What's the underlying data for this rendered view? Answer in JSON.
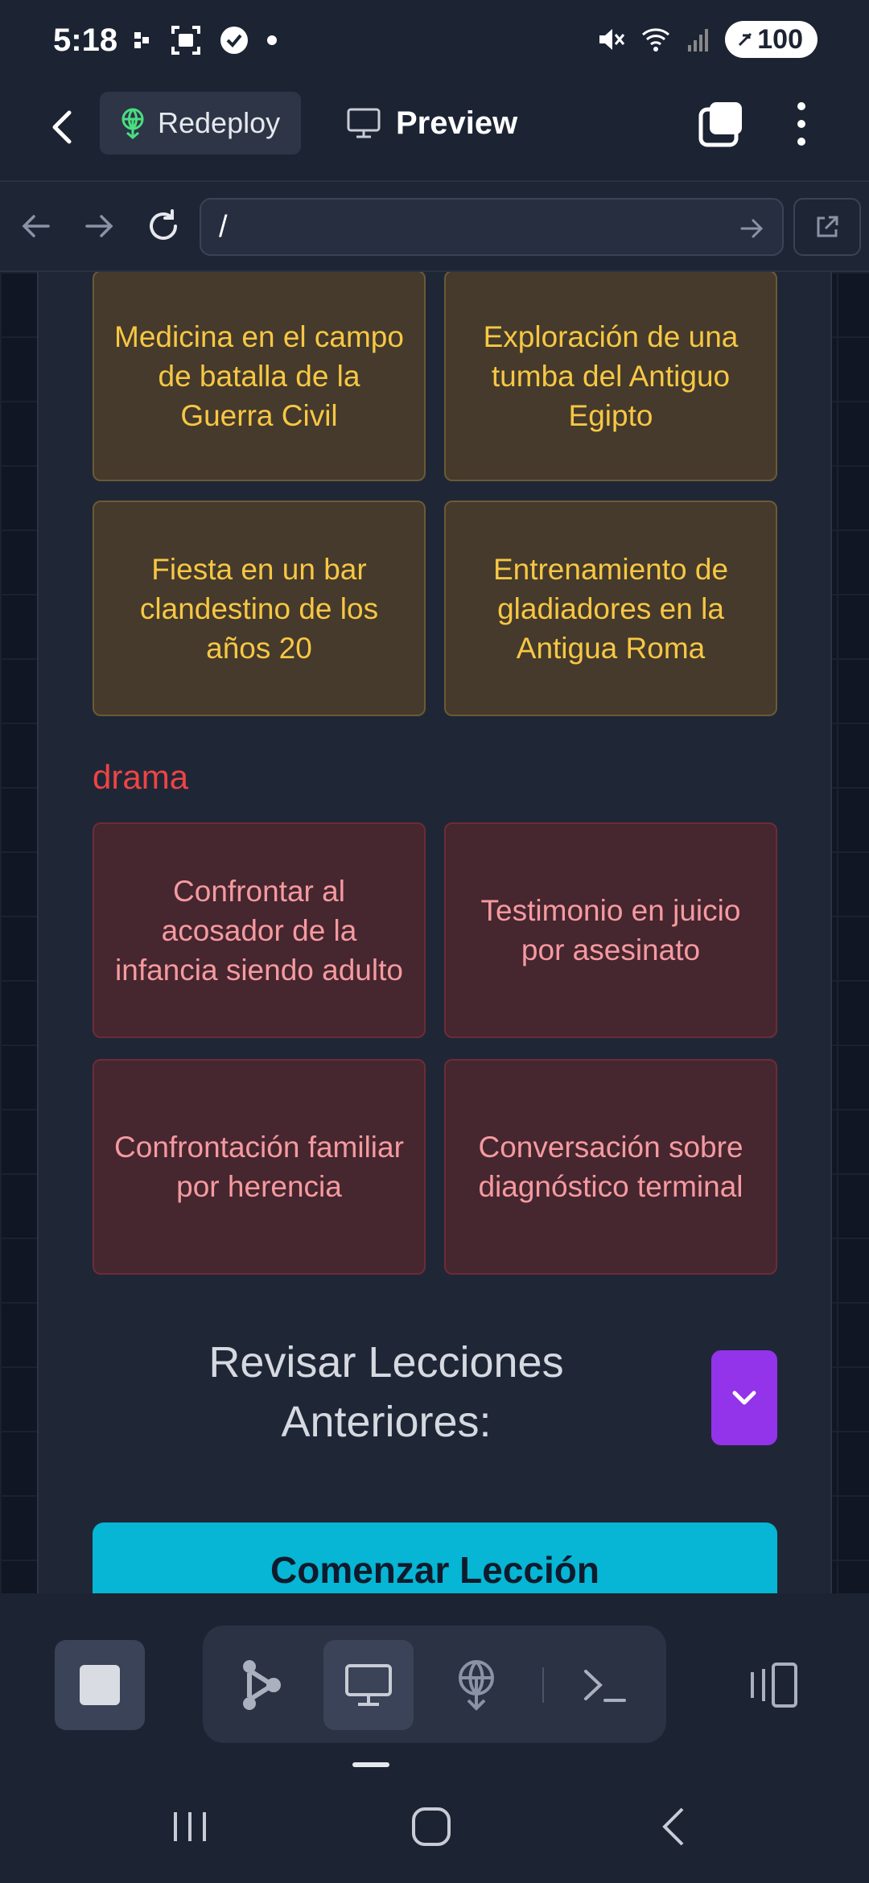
{
  "status_bar": {
    "time": "5:18",
    "battery": "100",
    "icons": [
      "notification-dots-icon",
      "screenshot-icon",
      "check-circle-icon",
      "dot-icon",
      "mute-icon",
      "wifi-icon",
      "signal-icon",
      "battery-icon"
    ]
  },
  "header": {
    "redeploy_label": "Redeploy",
    "preview_label": "Preview"
  },
  "url_bar": {
    "value": "/"
  },
  "content": {
    "history_cards": [
      "Medicina en el campo de batalla de la Guerra Civil",
      "Exploración de una tumba del Antiguo Egipto",
      "Fiesta en un bar clandestino de los años 20",
      "Entrenamiento de gladiadores en la Antigua Roma"
    ],
    "drama_label": "drama",
    "drama_cards": [
      "Confrontar al acosador de la infancia siendo adulto",
      "Testimonio en juicio por asesinato",
      "Confrontación familiar por herencia",
      "Conversación sobre diagnóstico terminal"
    ],
    "review_heading": "Revisar Lecciones Anteriores:",
    "start_button": "Comenzar Lección"
  },
  "colors": {
    "history_accent": "#f7c744",
    "drama_accent": "#ef4444",
    "toggle": "#9333ea",
    "start_button": "#06b6d4"
  }
}
